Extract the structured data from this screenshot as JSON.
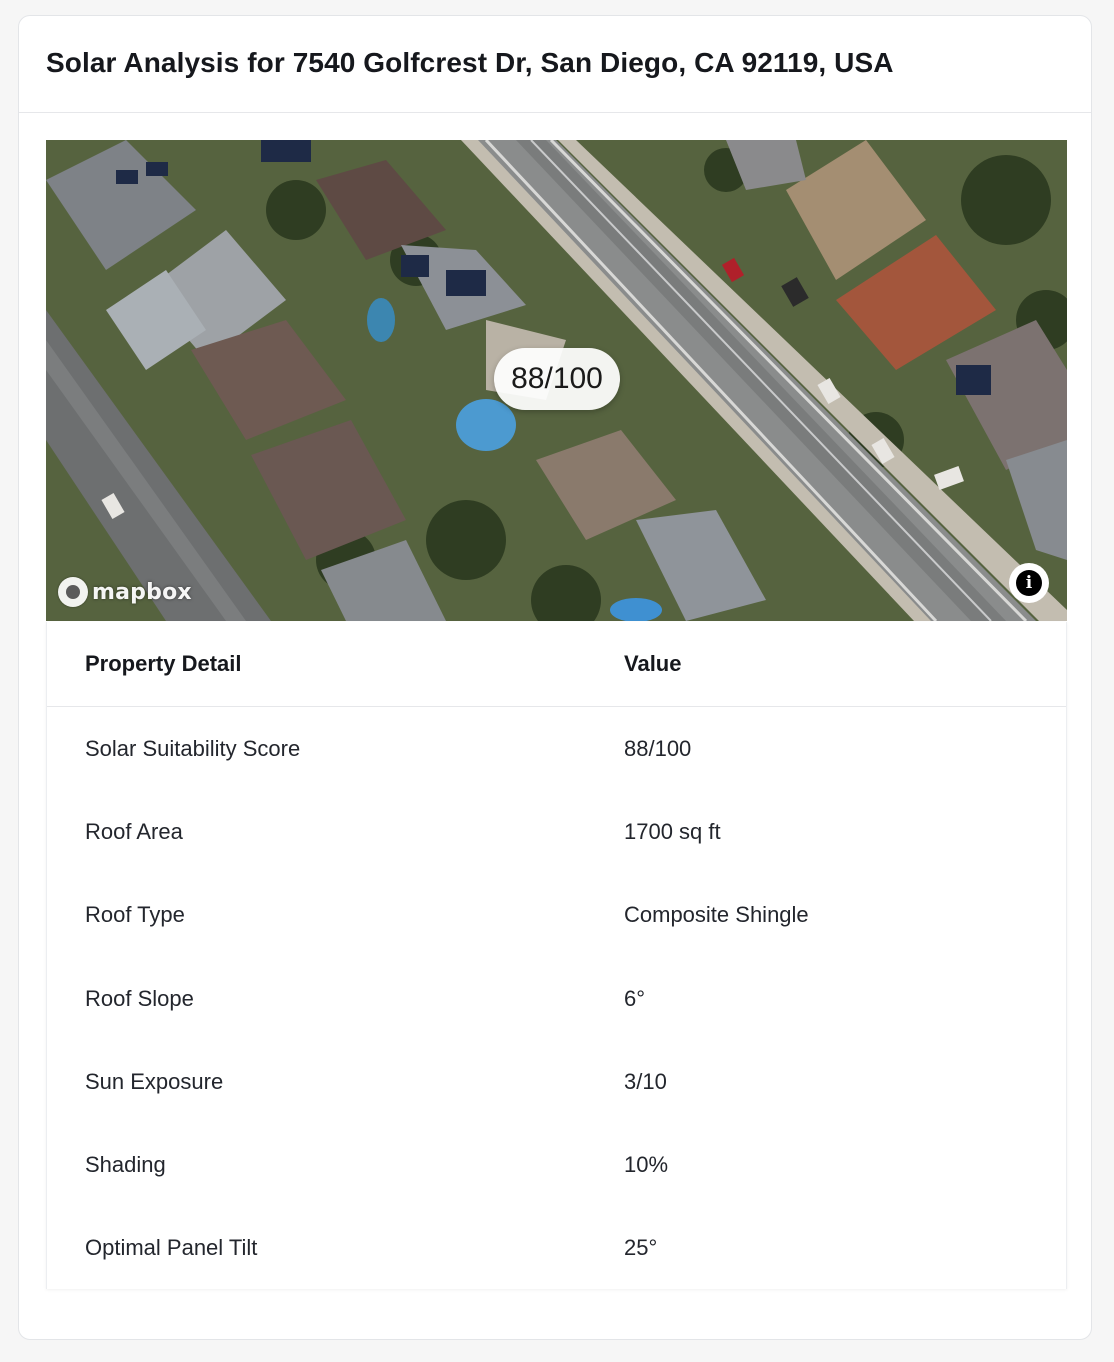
{
  "card": {
    "title": "Solar Analysis for 7540 Golfcrest Dr, San Diego, CA 92119, USA"
  },
  "map": {
    "score_badge": "88/100",
    "attribution_text": "mapbox",
    "attribution_icon": "mapbox-logo-icon",
    "info_icon": "info-icon"
  },
  "table": {
    "headers": {
      "detail": "Property Detail",
      "value": "Value"
    },
    "rows": [
      {
        "detail": "Solar Suitability Score",
        "value": "88/100"
      },
      {
        "detail": "Roof Area",
        "value": "1700 sq ft"
      },
      {
        "detail": "Roof Type",
        "value": "Composite Shingle"
      },
      {
        "detail": "Roof Slope",
        "value": "6°"
      },
      {
        "detail": "Sun Exposure",
        "value": "3/10"
      },
      {
        "detail": "Shading",
        "value": "10%"
      },
      {
        "detail": "Optimal Panel Tilt",
        "value": "25°"
      }
    ]
  }
}
